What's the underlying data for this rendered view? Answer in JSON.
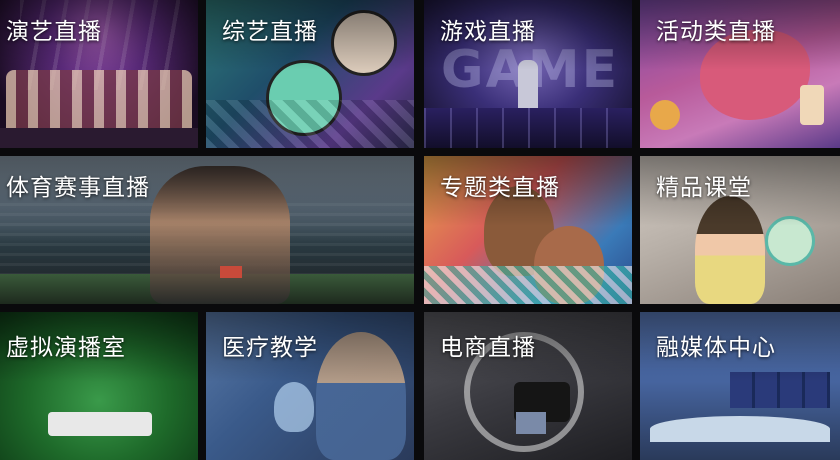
{
  "tiles": [
    {
      "id": "perf",
      "label": "演艺直播"
    },
    {
      "id": "variety",
      "label": "综艺直播"
    },
    {
      "id": "game",
      "label": "游戏直播",
      "scene_text": "GAME"
    },
    {
      "id": "event",
      "label": "活动类直播"
    },
    {
      "id": "sports",
      "label": "体育赛事直播"
    },
    {
      "id": "topic",
      "label": "专题类直播"
    },
    {
      "id": "course",
      "label": "精品课堂"
    },
    {
      "id": "virtual",
      "label": "虚拟演播室"
    },
    {
      "id": "medical",
      "label": "医疗教学"
    },
    {
      "id": "ecommerce",
      "label": "电商直播"
    },
    {
      "id": "media",
      "label": "融媒体中心"
    }
  ],
  "colors": {
    "page_bg": "#0a0a0c",
    "label_text": "#ffffff"
  }
}
